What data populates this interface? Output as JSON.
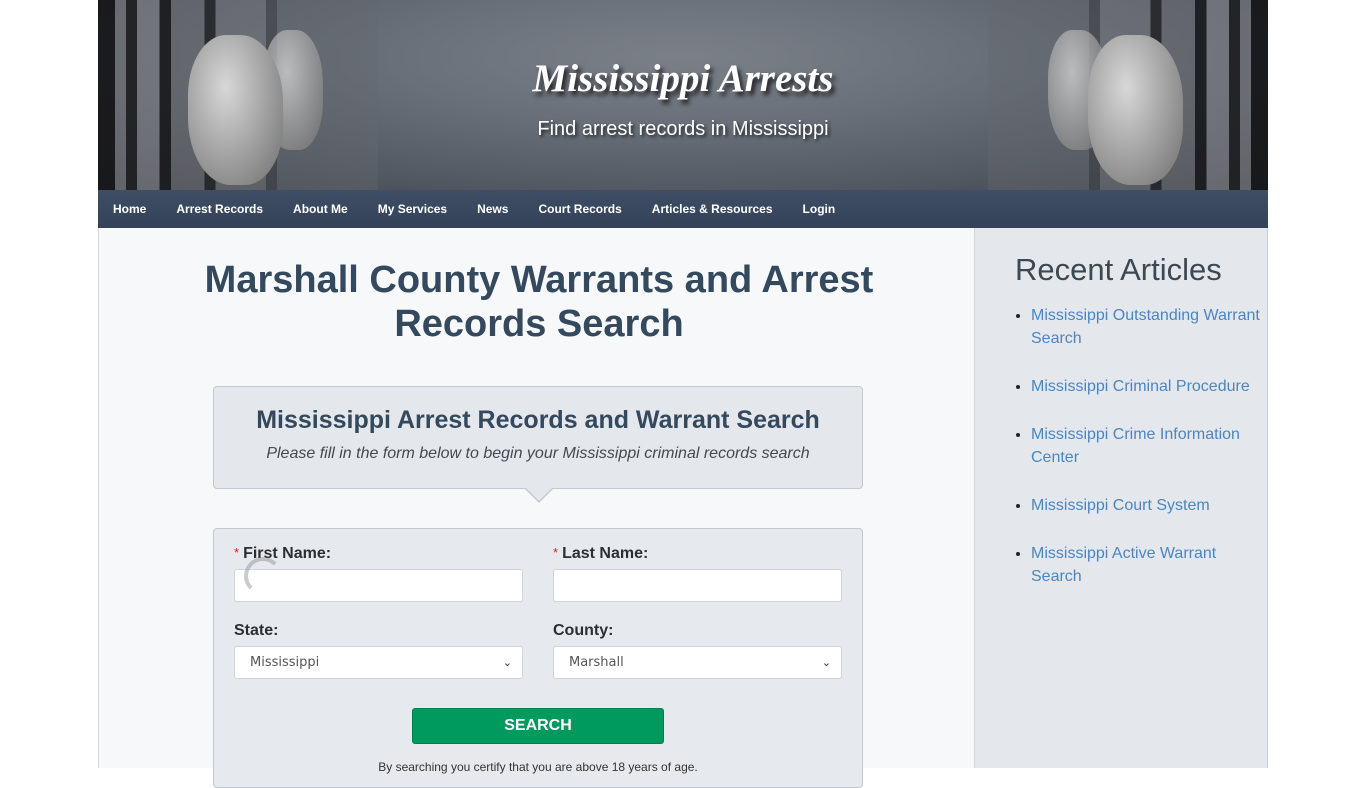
{
  "header": {
    "site_title": "Mississippi Arrests",
    "tagline": "Find arrest records in Mississippi"
  },
  "nav": {
    "items": [
      {
        "label": "Home"
      },
      {
        "label": "Arrest Records"
      },
      {
        "label": "About Me"
      },
      {
        "label": "My Services"
      },
      {
        "label": "News"
      },
      {
        "label": "Court Records"
      },
      {
        "label": "Articles & Resources"
      },
      {
        "label": "Login"
      }
    ]
  },
  "main": {
    "page_title": "Marshall County Warrants and Arrest Records Search",
    "intro": {
      "title": "Mississippi Arrest Records and Warrant Search",
      "subtitle": "Please fill in the form below to begin your Mississippi criminal records search"
    },
    "form": {
      "required_marker": "*",
      "first_name_label": "First Name:",
      "first_name_value": "",
      "last_name_label": "Last Name:",
      "last_name_value": "",
      "state_label": "State:",
      "state_selected": "Mississippi",
      "county_label": "County:",
      "county_selected": "Marshall",
      "chevron": "⌄",
      "search_label": "SEARCH",
      "certify_text": "By searching you certify that you are above 18 years of age."
    }
  },
  "sidebar": {
    "title": "Recent Articles",
    "articles": [
      {
        "label": "Mississippi Outstanding Warrant Search"
      },
      {
        "label": "Mississippi Criminal Procedure"
      },
      {
        "label": "Mississippi Crime Information Center"
      },
      {
        "label": "Mississippi Court System"
      },
      {
        "label": "Mississippi Active Warrant Search"
      }
    ]
  },
  "colors": {
    "nav_bg": "#3a4a61",
    "heading": "#34495e",
    "link": "#4a86c0",
    "search_button": "#00995e",
    "required": "#e02020"
  }
}
